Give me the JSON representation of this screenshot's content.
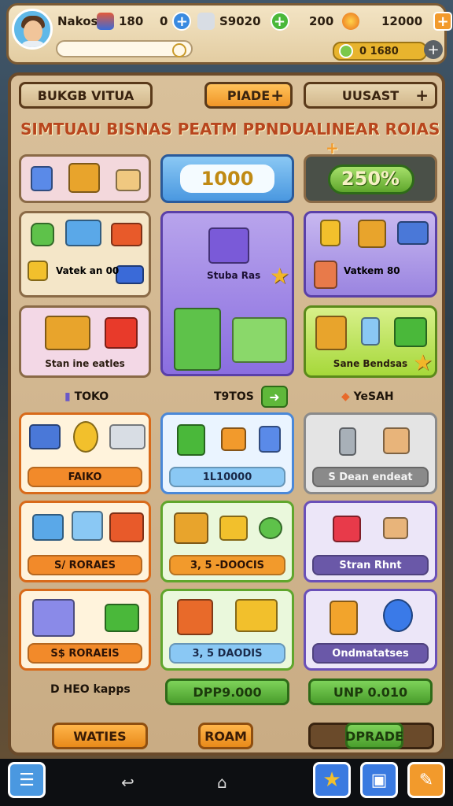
{
  "hud": {
    "player_name": "Nakos",
    "resource_1": "180",
    "resource_2_prefix": "0",
    "resource_3": "S9020",
    "resource_4": "200",
    "resource_5": "12000",
    "coins_value": "0  1680"
  },
  "tabs": {
    "left": "BUKGB VITUA",
    "middle": "PIADE",
    "right": "UUSAST"
  },
  "banner": {
    "title": "SIMTUAU BISNAS PEATM PPNDUAL",
    "right": "INEAR ROIAS"
  },
  "top_cards": {
    "counter": "1000",
    "percent": "250%"
  },
  "row2": {
    "left_label": "Vatek an 00",
    "middle_label": "Stuba Ras",
    "right_label": "Vatkem 80"
  },
  "row3": {
    "left_label": "Stan ine eatles",
    "right_label": "Sane Bendsas"
  },
  "captions": {
    "left": "TOKO",
    "middle": "T9TOS",
    "right": "YeSAH"
  },
  "shop": {
    "r1": [
      "FAIKO",
      "1L10000",
      "S Dean endeat"
    ],
    "r2": [
      "S/ RORAES",
      "3, 5 -DOOCIS",
      "Stran Rhnt"
    ],
    "r3": [
      "S$ RORAEIS",
      "3, 5 DAODIS",
      "Ondmatatses"
    ]
  },
  "bottom": {
    "caption": "D HEO kapps",
    "middle_btn": "DPP9.000",
    "right_btn": "UNP 0.010",
    "btn_left": "WATIES",
    "btn_middle": "ROAM",
    "btn_right": "DPRADE"
  },
  "colors": {
    "accent_orange": "#f29a2c",
    "accent_green": "#5fb83a",
    "panel_brown": "#6a4a2a"
  }
}
